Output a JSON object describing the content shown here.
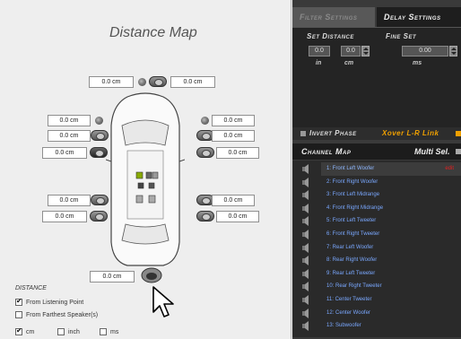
{
  "map": {
    "title": "Distance Map",
    "fields": {
      "top_left": "0.0 cm",
      "top_right": "0.0 cm",
      "left_1": "0.0 cm",
      "left_2": "0.0 cm",
      "left_3": "0.0 cm",
      "right_1": "0.0 cm",
      "right_2": "0.0 cm",
      "right_3": "0.0 cm",
      "rear_left_1": "0.0 cm",
      "rear_left_2": "0.0 cm",
      "rear_right_1": "0.0 cm",
      "rear_right_2": "0.0 cm",
      "subwoofer": "0.0 cm"
    },
    "distance_label": "DISTANCE",
    "options": {
      "from_listening": "From Listening Point",
      "from_farthest": "From Farthest Speaker(s)"
    },
    "units": {
      "cm": "cm",
      "inch": "inch",
      "ms": "ms"
    }
  },
  "tabs": {
    "filter": "Filter Settings",
    "delay": "Delay Settings"
  },
  "delay": {
    "set_distance_label": "Set Distance",
    "fine_set_label": "Fine Set",
    "in_value": "0.0",
    "cm_value": "0.0",
    "fine_value": "0.00",
    "unit_in": "in",
    "unit_cm": "cm",
    "unit_ms": "ms"
  },
  "controls": {
    "invert_phase": "Invert Phase",
    "xover_link": "Xover L-R Link"
  },
  "channel_map": {
    "title": "Channel Map",
    "multi_sel": "Multi Sel.",
    "edit_label": "edit",
    "channels": [
      "1: Front Left Woofer",
      "2: Front Right Woofer",
      "3: Front Left Midrange",
      "4: Front Right Midrange",
      "5: Front Left Tweeter",
      "6: Front Right Tweeter",
      "7: Rear Left Woofer",
      "8: Rear Right Woofer",
      "9: Rear Left Tweeter",
      "10: Rear Right Tweeter",
      "11: Center Tweeter",
      "12: Center Woofer",
      "13: Subwoofer"
    ]
  }
}
